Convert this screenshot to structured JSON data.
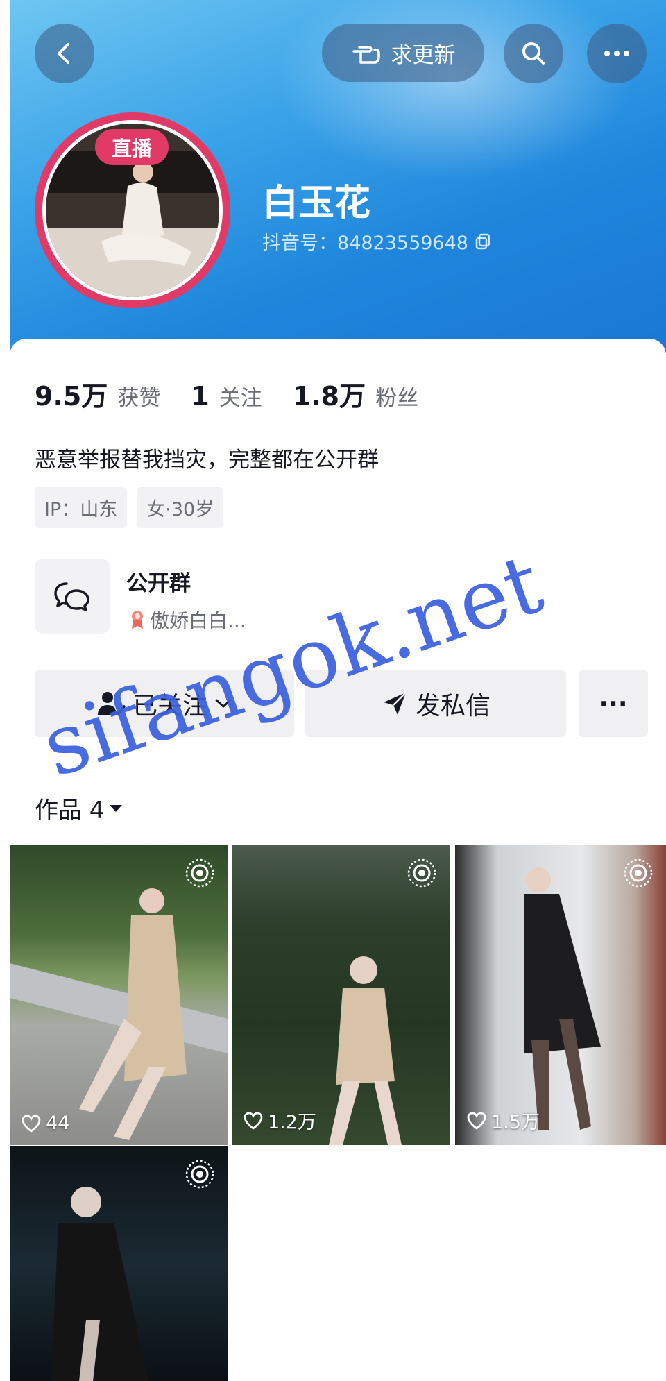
{
  "header": {
    "request_update_label": "求更新",
    "live_badge": "直播",
    "username": "白玉花",
    "douyin_id": "抖音号：84823559648"
  },
  "stats": [
    {
      "value": "9.5万",
      "label": "获赞"
    },
    {
      "value": "1",
      "label": "关注"
    },
    {
      "value": "1.8万",
      "label": "粉丝"
    }
  ],
  "bio": "恶意举报替我挡灾，完整都在公开群",
  "tags": [
    "IP：山东",
    "女·30岁"
  ],
  "group": {
    "title": "公开群",
    "subtitle": "傲娇白白..."
  },
  "actions": {
    "following_label": "已关注",
    "message_label": "发私信",
    "more_label": "···"
  },
  "works": {
    "label": "作品 4",
    "items": [
      {
        "likes": "44"
      },
      {
        "likes": "1.2万"
      },
      {
        "likes": "1.5万"
      },
      {
        "likes": ""
      }
    ]
  },
  "watermark": "sifangok.net",
  "colors": {
    "header_blue": "#1f86dc",
    "live_pink": "#e13a67",
    "watermark_blue": "#3a5fe0"
  }
}
